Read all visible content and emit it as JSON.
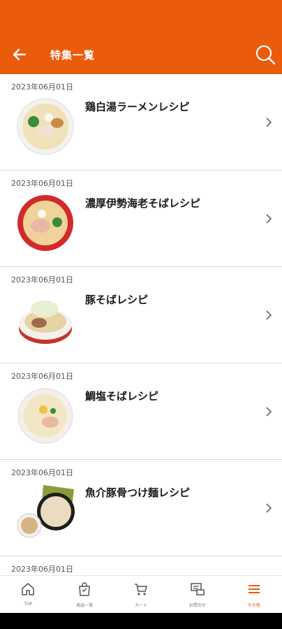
{
  "header": {
    "title": "特集一覧"
  },
  "items": [
    {
      "date": "2023年06月01日",
      "title": "鶏白湯ラーメンレシピ"
    },
    {
      "date": "2023年06月01日",
      "title": "濃厚伊勢海老そばレシピ"
    },
    {
      "date": "2023年06月01日",
      "title": "豚そばレシピ"
    },
    {
      "date": "2023年06月01日",
      "title": "鯛塩そばレシピ"
    },
    {
      "date": "2023年06月01日",
      "title": "魚介豚骨つけ麺レシピ"
    },
    {
      "date": "2023年06月01日",
      "title": ""
    }
  ],
  "tabs": [
    {
      "label": "TOP",
      "icon": "home-icon"
    },
    {
      "label": "商品一覧",
      "icon": "shopping-bag-icon"
    },
    {
      "label": "カート",
      "icon": "cart-icon"
    },
    {
      "label": "お問合せ",
      "icon": "contact-icon"
    },
    {
      "label": "その他",
      "icon": "menu-icon"
    }
  ],
  "colors": {
    "brand": "#ea5b0c",
    "divider": "#d9d9d9"
  }
}
